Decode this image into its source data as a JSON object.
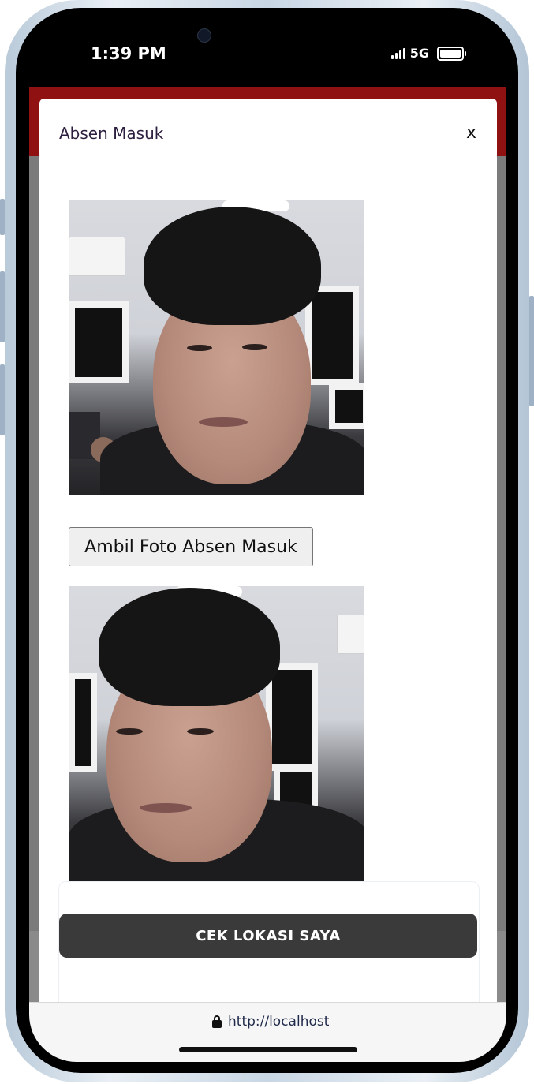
{
  "status_bar": {
    "time": "1:39 PM",
    "network": "5G"
  },
  "modal": {
    "title": "Absen Masuk",
    "close_label": "x",
    "capture_button_label": "Ambil Foto Absen Masuk",
    "location_button_label": "CEK LOKASI SAYA"
  },
  "browser": {
    "url": "http://localhost"
  },
  "colors": {
    "header_red": "#8f1111",
    "dark_button": "#3a3a3a"
  }
}
